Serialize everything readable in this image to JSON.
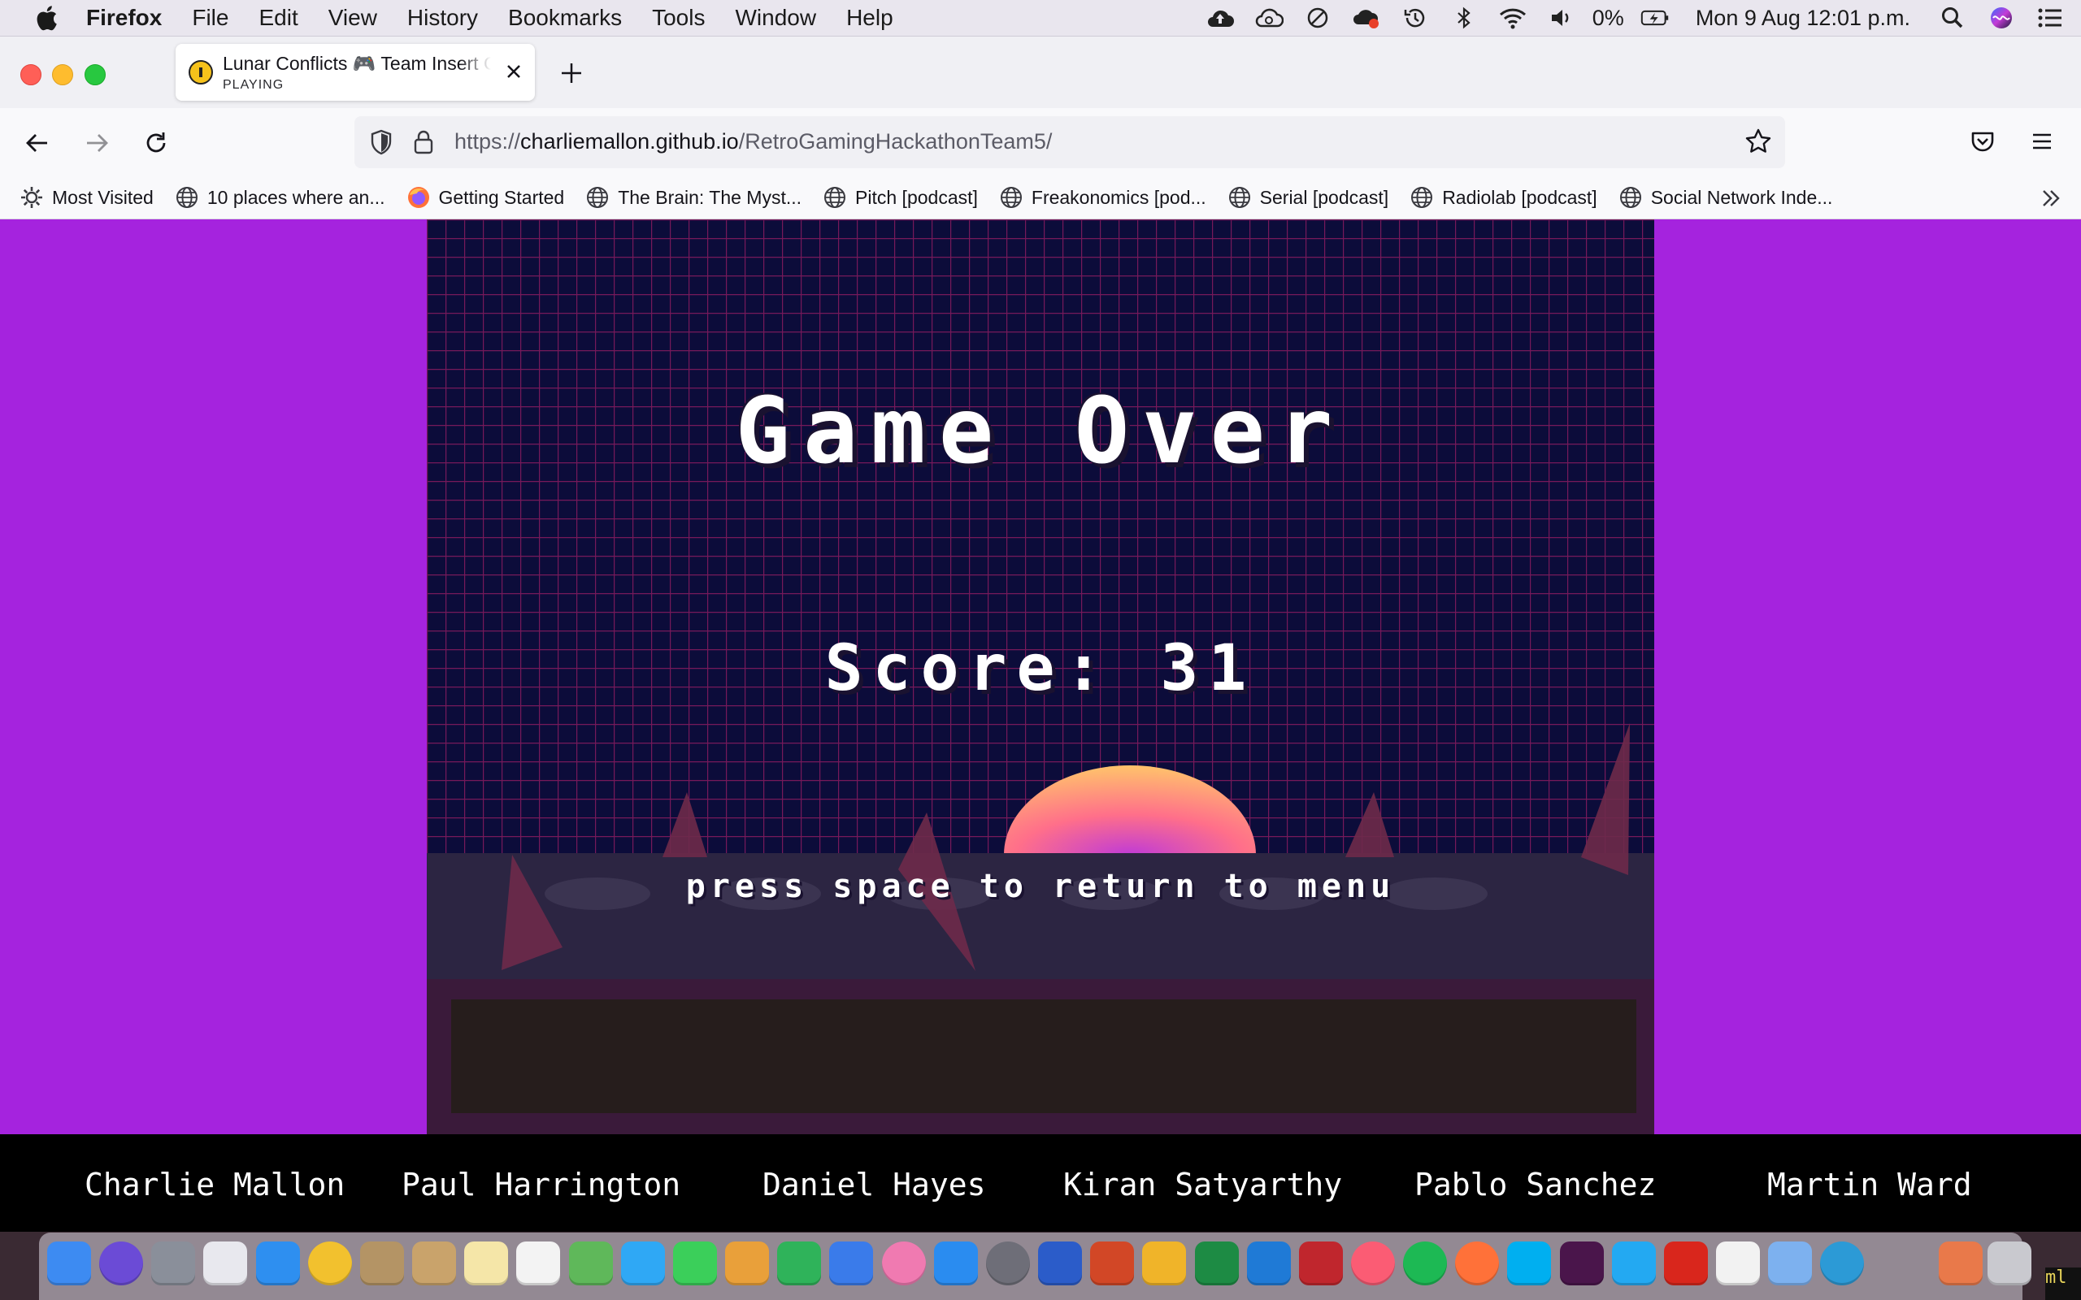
{
  "menubar": {
    "app_name": "Firefox",
    "items": [
      "File",
      "Edit",
      "View",
      "History",
      "Bookmarks",
      "Tools",
      "Window",
      "Help"
    ],
    "battery_percent": "0%",
    "datetime": "Mon 9 Aug  12:01 p.m."
  },
  "tab": {
    "title": "Lunar Conflicts 🎮 Team Insert C",
    "status": "PLAYING"
  },
  "urlbar": {
    "url_prefix": "https://",
    "url_host": "charliemallon.github.io",
    "url_path": "/RetroGamingHackathonTeam5/"
  },
  "bookmarks": [
    {
      "label": "Most Visited",
      "icon": "gear-icon"
    },
    {
      "label": "10 places where an...",
      "icon": "globe-icon"
    },
    {
      "label": "Getting Started",
      "icon": "firefox-icon"
    },
    {
      "label": "The Brain: The Myst...",
      "icon": "globe-icon"
    },
    {
      "label": "Pitch [podcast]",
      "icon": "globe-icon"
    },
    {
      "label": "Freakonomics [pod...",
      "icon": "globe-icon"
    },
    {
      "label": "Serial [podcast]",
      "icon": "globe-icon"
    },
    {
      "label": "Radiolab [podcast]",
      "icon": "globe-icon"
    },
    {
      "label": "Social Network Inde...",
      "icon": "globe-icon"
    }
  ],
  "game": {
    "title": "Game Over",
    "score_label": "Score: 31",
    "prompt": "press space to return to menu",
    "colors": {
      "page_background": "#a523de",
      "sky": "#0c0c3a",
      "grid": "#7a1c5c",
      "ground": "#2c2542",
      "panel": "#261d1c"
    }
  },
  "credits": [
    "Charlie Mallon",
    "Paul Harrington",
    "Daniel Hayes",
    "Kiran Satyarthy",
    "Pablo Sanchez",
    "Martin Ward"
  ],
  "terminal_peek": "ml",
  "dock_apps": [
    "finder",
    "siri",
    "launchpad",
    "app-grid",
    "safari",
    "chrome",
    "preview",
    "notes-brown",
    "notes",
    "reminders",
    "maps",
    "messages",
    "facetime",
    "keynote-stack",
    "numbers",
    "keynote",
    "photos",
    "app-store",
    "system-preferences",
    "word",
    "powerpoint",
    "outlook-o",
    "excel",
    "c-app",
    "filezilla",
    "music",
    "spotify",
    "firefox",
    "skype",
    "slack",
    "vscode",
    "acrobat",
    "textedit",
    "preview-2",
    "edge",
    "book-app",
    "trash"
  ]
}
